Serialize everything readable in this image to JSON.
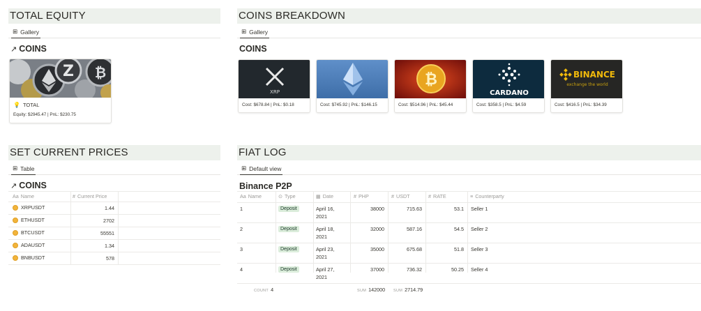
{
  "sections": {
    "total_equity": {
      "title": "TOTAL EQUITY",
      "view": "Gallery",
      "db_title": "COINS",
      "card": {
        "name": "TOTAL",
        "subtitle": "Equity: $2945.47 | PnL: $230.75"
      }
    },
    "coins_breakdown": {
      "title": "COINS BREAKDOWN",
      "view": "Gallery",
      "db_title": "COINS",
      "cards": [
        {
          "image": "xrp-logo",
          "logo_text": "XRP",
          "subtitle": "Cost: $678.84 | PnL: $0.18"
        },
        {
          "image": "ethereum-logo",
          "subtitle": "Cost: $745.92 | PnL: $146.15"
        },
        {
          "image": "bitcoin-coin",
          "subtitle": "Cost: $514.96 | PnL: $45.44"
        },
        {
          "image": "cardano-logo",
          "logo_text": "CARDANO",
          "subtitle": "Cost: $358.5 | PnL: $4.59"
        },
        {
          "image": "binance-logo",
          "logo_text": "BINANCE",
          "logo_tagline": "exchange the world",
          "subtitle": "Cost: $416.5 | PnL: $34.39"
        }
      ]
    },
    "set_current_prices": {
      "title": "SET CURRENT PRICES",
      "view": "Table",
      "db_title": "COINS",
      "columns": [
        "Name",
        "Current Price"
      ],
      "rows": [
        {
          "name": "XRPUSDT",
          "price": "1.44"
        },
        {
          "name": "ETHUSDT",
          "price": "2702"
        },
        {
          "name": "BTCUSDT",
          "price": "55551"
        },
        {
          "name": "ADAUSDT",
          "price": "1.34"
        },
        {
          "name": "BNBUSDT",
          "price": "578"
        }
      ]
    },
    "fiat_log": {
      "title": "FIAT LOG",
      "view": "Default view",
      "db_title": "Binance P2P",
      "columns": [
        "Name",
        "Type",
        "Date",
        "PHP",
        "USDT",
        "RATE",
        "Counterparty"
      ],
      "rows": [
        {
          "name": "1",
          "type": "Deposit",
          "date_l1": "April 16,",
          "date_l2": "2021",
          "php": "38000",
          "usdt": "715.63",
          "rate": "53.1",
          "counterparty": "Seller 1"
        },
        {
          "name": "2",
          "type": "Deposit",
          "date_l1": "April 18,",
          "date_l2": "2021",
          "php": "32000",
          "usdt": "587.16",
          "rate": "54.5",
          "counterparty": "Seller 2"
        },
        {
          "name": "3",
          "type": "Deposit",
          "date_l1": "April 23,",
          "date_l2": "2021",
          "php": "35000",
          "usdt": "675.68",
          "rate": "51.8",
          "counterparty": "Seller 3"
        },
        {
          "name": "4",
          "type": "Deposit",
          "date_l1": "April 27,",
          "date_l2": "2021",
          "php": "37000",
          "usdt": "736.32",
          "rate": "50.25",
          "counterparty": "Seller 4"
        }
      ],
      "footer": {
        "count_label": "COUNT",
        "count_value": "4",
        "php_label": "SUM",
        "php_value": "142000",
        "usdt_label": "SUM",
        "usdt_value": "2714.79"
      }
    }
  },
  "colors": {
    "header_bg": "#edf1ec",
    "tag_bg": "#dbeddb",
    "coin_dot": "#f2b43c",
    "binance_yellow": "#f0b90b"
  }
}
